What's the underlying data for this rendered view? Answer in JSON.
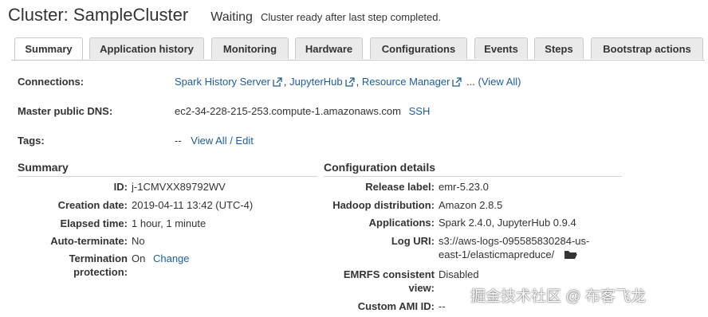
{
  "header": {
    "title": "Cluster: SampleCluster",
    "status": "Waiting",
    "status_description": "Cluster ready after last step completed."
  },
  "tabs": [
    {
      "label": "Summary",
      "active": true
    },
    {
      "label": "Application history",
      "active": false
    },
    {
      "label": "Monitoring",
      "active": false
    },
    {
      "label": "Hardware",
      "active": false
    },
    {
      "label": "Configurations",
      "active": false
    },
    {
      "label": "Events",
      "active": false
    },
    {
      "label": "Steps",
      "active": false
    },
    {
      "label": "Bootstrap actions",
      "active": false
    }
  ],
  "connections": {
    "label": "Connections:",
    "links": [
      "Spark History Server",
      "JupyterHub",
      "Resource Manager"
    ],
    "ellipsis": "...",
    "view_all": "(View All)"
  },
  "master_dns": {
    "label": "Master public DNS:",
    "value": "ec2-34-228-215-253.compute-1.amazonaws.com",
    "ssh": "SSH"
  },
  "tags": {
    "label": "Tags:",
    "value": "--",
    "link": "View All / Edit"
  },
  "summary": {
    "title": "Summary",
    "rows": [
      {
        "label": "ID:",
        "value": "j-1CMVXX89792WV"
      },
      {
        "label": "Creation date:",
        "value": "2019-04-11 13:42 (UTC-4)"
      },
      {
        "label": "Elapsed time:",
        "value": "1 hour, 1 minute"
      },
      {
        "label": "Auto-terminate:",
        "value": "No"
      },
      {
        "label": "Termination protection:",
        "value": "On",
        "link": "Change"
      }
    ]
  },
  "configuration": {
    "title": "Configuration details",
    "rows": [
      {
        "label": "Release label:",
        "value": "emr-5.23.0"
      },
      {
        "label": "Hadoop distribution:",
        "value": "Amazon 2.8.5"
      },
      {
        "label": "Applications:",
        "value": "Spark 2.4.0, JupyterHub 0.9.4"
      },
      {
        "label": "Log URI:",
        "value": "s3://aws-logs-095585830284-us-east-1/elasticmapreduce/"
      },
      {
        "label": "EMRFS consistent view:",
        "value": "Disabled"
      },
      {
        "label": "Custom AMI ID:",
        "value": "--"
      }
    ]
  },
  "watermark": "掘金技术社区 @ 布客飞龙",
  "colors": {
    "link": "#1e5d9b",
    "text": "#333333",
    "tab_bg": "#eaeaea",
    "border": "#c9c9c9"
  },
  "icons": {
    "external_link": "external-link-icon",
    "folder": "folder-icon"
  }
}
